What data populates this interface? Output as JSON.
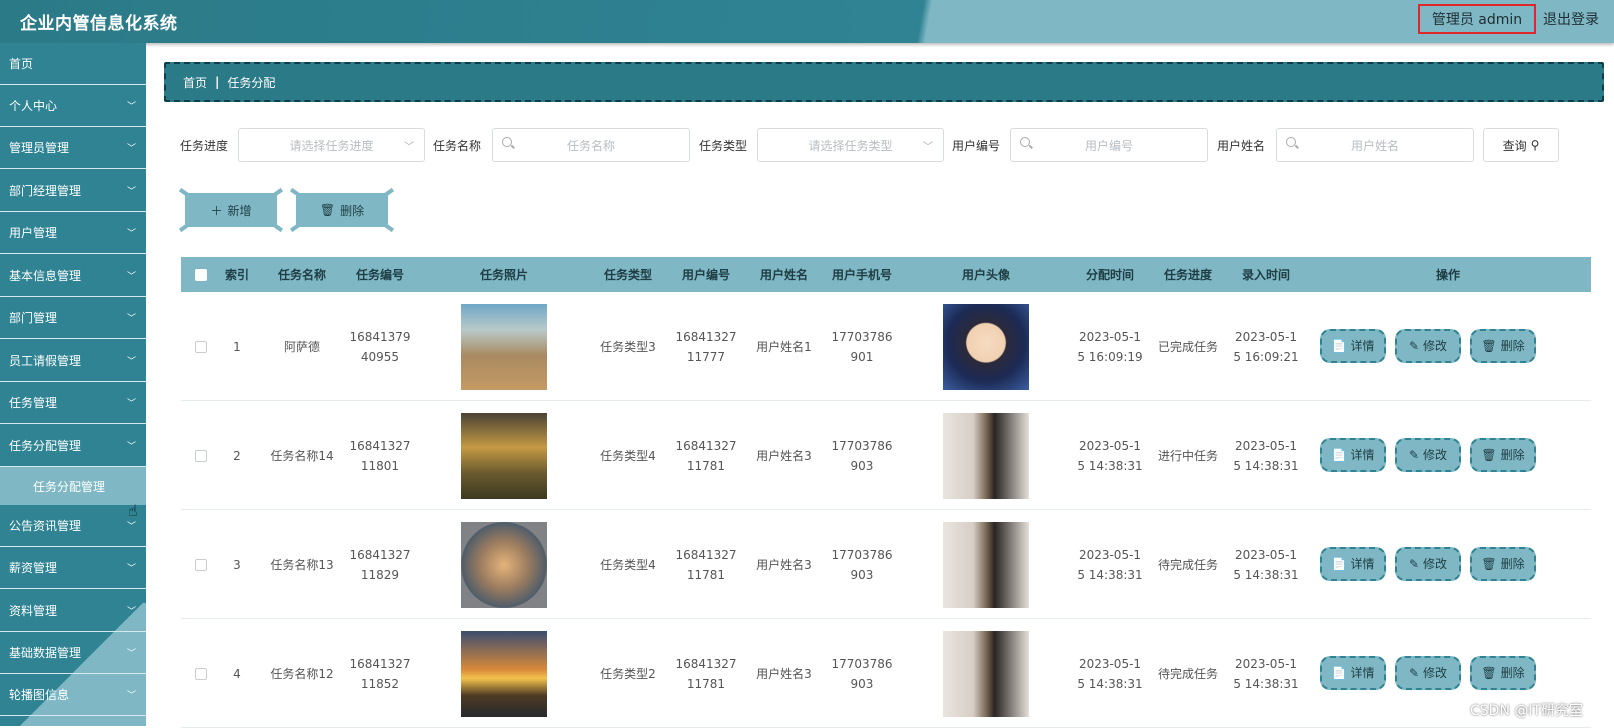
{
  "header": {
    "title": "企业内管信息化系统",
    "user_label": "管理员 admin",
    "logout_label": "退出登录"
  },
  "sidebar": {
    "items": [
      {
        "label": "首页",
        "has_chevron": false
      },
      {
        "label": "个人中心",
        "has_chevron": true
      },
      {
        "label": "管理员管理",
        "has_chevron": true
      },
      {
        "label": "部门经理管理",
        "has_chevron": true
      },
      {
        "label": "用户管理",
        "has_chevron": true
      },
      {
        "label": "基本信息管理",
        "has_chevron": true
      },
      {
        "label": "部门管理",
        "has_chevron": true
      },
      {
        "label": "员工请假管理",
        "has_chevron": true
      },
      {
        "label": "任务管理",
        "has_chevron": true
      },
      {
        "label": "任务分配管理",
        "has_chevron": true
      },
      {
        "label": "公告资讯管理",
        "has_chevron": true
      },
      {
        "label": "薪资管理",
        "has_chevron": true
      },
      {
        "label": "资料管理",
        "has_chevron": true
      },
      {
        "label": "基础数据管理",
        "has_chevron": true
      },
      {
        "label": "轮播图信息",
        "has_chevron": true
      }
    ],
    "active_sub": "任务分配管理"
  },
  "breadcrumb": {
    "home": "首页",
    "current": "任务分配"
  },
  "filters": {
    "progress_label": "任务进度",
    "progress_placeholder": "请选择任务进度",
    "name_label": "任务名称",
    "name_placeholder": "任务名称",
    "type_label": "任务类型",
    "type_placeholder": "请选择任务类型",
    "user_no_label": "用户编号",
    "user_no_placeholder": "用户编号",
    "user_name_label": "用户姓名",
    "user_name_placeholder": "用户姓名",
    "query_label": "查询"
  },
  "actions": {
    "add_label": "新增",
    "delete_label": "删除"
  },
  "table": {
    "headers": [
      "索引",
      "任务名称",
      "任务编号",
      "任务照片",
      "任务类型",
      "用户编号",
      "用户姓名",
      "用户手机号",
      "用户头像",
      "分配时间",
      "任务进度",
      "录入时间",
      "操作"
    ],
    "rows": [
      {
        "index": "1",
        "task_name": "阿萨德",
        "task_no": [
          "16841379",
          "40955"
        ],
        "photo": "valley-photo",
        "task_type": "任务类型3",
        "user_no": [
          "16841327",
          "11777"
        ],
        "user_name": "用户姓名1",
        "phone": [
          "17703786",
          "901"
        ],
        "avatar": "conan-avatar",
        "assign_time": [
          "2023-05-1",
          "5 16:09:19"
        ],
        "progress": "已完成任务",
        "entry_time": [
          "2023-05-1",
          "5 16:09:21"
        ]
      },
      {
        "index": "2",
        "task_name": "任务名称14",
        "task_no": [
          "16841327",
          "11801"
        ],
        "photo": "sunset-photo",
        "task_type": "任务类型4",
        "user_no": [
          "16841327",
          "11781"
        ],
        "user_name": "用户姓名3",
        "phone": [
          "17703786",
          "903"
        ],
        "avatar": "person-avatar",
        "assign_time": [
          "2023-05-1",
          "5 14:38:31"
        ],
        "progress": "进行中任务",
        "entry_time": [
          "2023-05-1",
          "5 14:38:31"
        ]
      },
      {
        "index": "3",
        "task_name": "任务名称13",
        "task_no": [
          "16841327",
          "11829"
        ],
        "photo": "round-landscape-photo",
        "task_type": "任务类型4",
        "user_no": [
          "16841327",
          "11781"
        ],
        "user_name": "用户姓名3",
        "phone": [
          "17703786",
          "903"
        ],
        "avatar": "person-avatar",
        "assign_time": [
          "2023-05-1",
          "5 14:38:31"
        ],
        "progress": "待完成任务",
        "entry_time": [
          "2023-05-1",
          "5 14:38:31"
        ]
      },
      {
        "index": "4",
        "task_name": "任务名称12",
        "task_no": [
          "16841327",
          "11852"
        ],
        "photo": "road-sunset-photo",
        "task_type": "任务类型2",
        "user_no": [
          "16841327",
          "11781"
        ],
        "user_name": "用户姓名3",
        "phone": [
          "17703786",
          "903"
        ],
        "avatar": "person-avatar",
        "assign_time": [
          "2023-05-1",
          "5 14:38:31"
        ],
        "progress": "待完成任务",
        "entry_time": [
          "2023-05-1",
          "5 14:38:31"
        ]
      }
    ],
    "op_labels": {
      "detail": "详情",
      "edit": "修改",
      "delete": "删除"
    }
  },
  "watermark": "CSDN @IT研究室",
  "colors": {
    "primary": "#2f8393",
    "accent": "#7fb8c4",
    "header_dark": "#2b7a88",
    "highlight_border": "#e0262b"
  }
}
